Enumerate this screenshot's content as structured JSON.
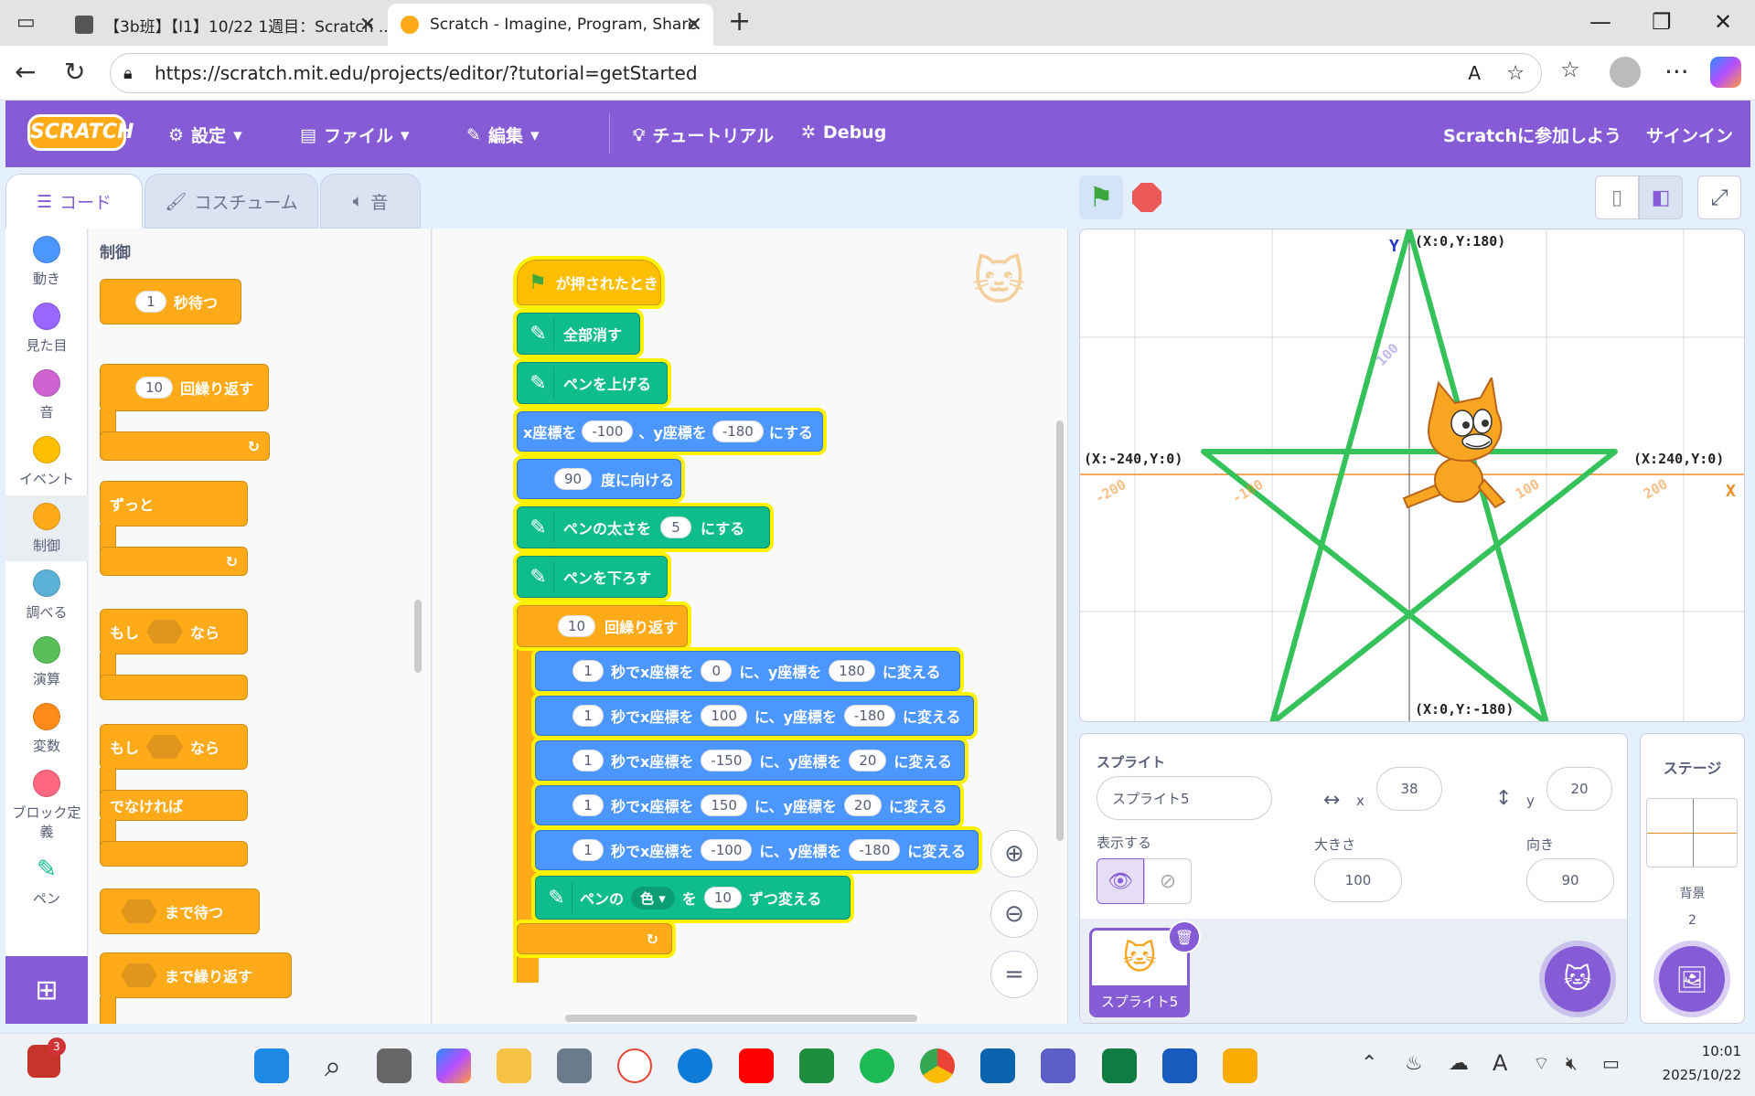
{
  "browser": {
    "tabs": [
      {
        "title": "【3b班】【I1】10/22 1週目：Scratch ...",
        "active": false
      },
      {
        "title": "Scratch - Imagine, Program, Share",
        "active": true
      }
    ],
    "url": "https://scratch.mit.edu/projects/editor/?tutorial=getStarted"
  },
  "menubar": {
    "logo": "SCRATCH",
    "settings": "設定",
    "file": "ファイル",
    "edit": "編集",
    "tutorial": "チュートリアル",
    "debug": "Debug",
    "join": "Scratchに参加しよう",
    "signin": "サインイン"
  },
  "editor_tabs": {
    "code": "コード",
    "costume": "コスチューム",
    "sound": "音"
  },
  "categories": [
    {
      "label": "動き",
      "color": "#4c97ff"
    },
    {
      "label": "見た目",
      "color": "#9966ff"
    },
    {
      "label": "音",
      "color": "#cf63cf"
    },
    {
      "label": "イベント",
      "color": "#ffbf00"
    },
    {
      "label": "制御",
      "color": "#ffab19"
    },
    {
      "label": "調べる",
      "color": "#5cb1d6"
    },
    {
      "label": "演算",
      "color": "#59c059"
    },
    {
      "label": "変数",
      "color": "#ff8c1a"
    },
    {
      "label": "ブロック定義",
      "color": "#ff6680"
    },
    {
      "label": "ペン",
      "color": "#0fbd8c"
    }
  ],
  "palette": {
    "heading": "制御",
    "wait_value": "1",
    "wait_label": "秒待つ",
    "repeat_value": "10",
    "repeat_label": "回繰り返す",
    "forever_label": "ずっと",
    "if_label": "もし",
    "then_label": "なら",
    "else_label": "でなければ",
    "wait_until_label": "まで待つ",
    "repeat_until_label": "まで繰り返す"
  },
  "script": {
    "hat": "が押されたとき",
    "clear": "全部消す",
    "pen_up": "ペンを上げる",
    "goto_x_label": "x座標を",
    "goto_x": "-100",
    "goto_y_label": "、y座標を",
    "goto_y": "-180",
    "goto_end": "にする",
    "point_value": "90",
    "point_label": "度に向ける",
    "size_label": "ペンの太さを",
    "size_value": "5",
    "size_end": "にする",
    "pen_down": "ペンを下ろす",
    "repeat_value": "10",
    "repeat_label": "回繰り返す",
    "glide_sec_label": "秒でx座標を",
    "glide_y_label": "に、y座標を",
    "glide_end": "に変える",
    "glides": [
      {
        "sec": "1",
        "x": "0",
        "y": "180"
      },
      {
        "sec": "1",
        "x": "100",
        "y": "-180"
      },
      {
        "sec": "1",
        "x": "-150",
        "y": "20"
      },
      {
        "sec": "1",
        "x": "150",
        "y": "20"
      },
      {
        "sec": "1",
        "x": "-100",
        "y": "-180"
      }
    ],
    "pen_color_label": "ペンの",
    "pen_color_param": "色",
    "pen_color_wo": "を",
    "pen_color_value": "10",
    "pen_color_end": "ずつ変える"
  },
  "stage": {
    "top_label": "(X:0,Y:180)",
    "bottom_label": "(X:0,Y:-180)",
    "left_label": "(X:-240,Y:0)",
    "right_label": "(X:240,Y:0)",
    "y_axis": "Y",
    "x_axis": "X",
    "tick_100": "100",
    "tick_m100": "-100",
    "tick_200": "200",
    "tick_m200": "-200",
    "line_color": "#36c25a"
  },
  "sprite": {
    "heading": "スプライト",
    "name": "スプライト5",
    "x_label": "x",
    "x": "38",
    "y_label": "y",
    "y": "20",
    "show_label": "表示する",
    "size_label": "大きさ",
    "size": "100",
    "direction_label": "向き",
    "direction": "90",
    "thumb_label": "スプライト5"
  },
  "stage_panel": {
    "heading": "ステージ",
    "backdrop_label": "背景",
    "backdrop_count": "2"
  },
  "taskbar": {
    "badge": "3",
    "time": "10:01",
    "date": "2025/10/22"
  }
}
